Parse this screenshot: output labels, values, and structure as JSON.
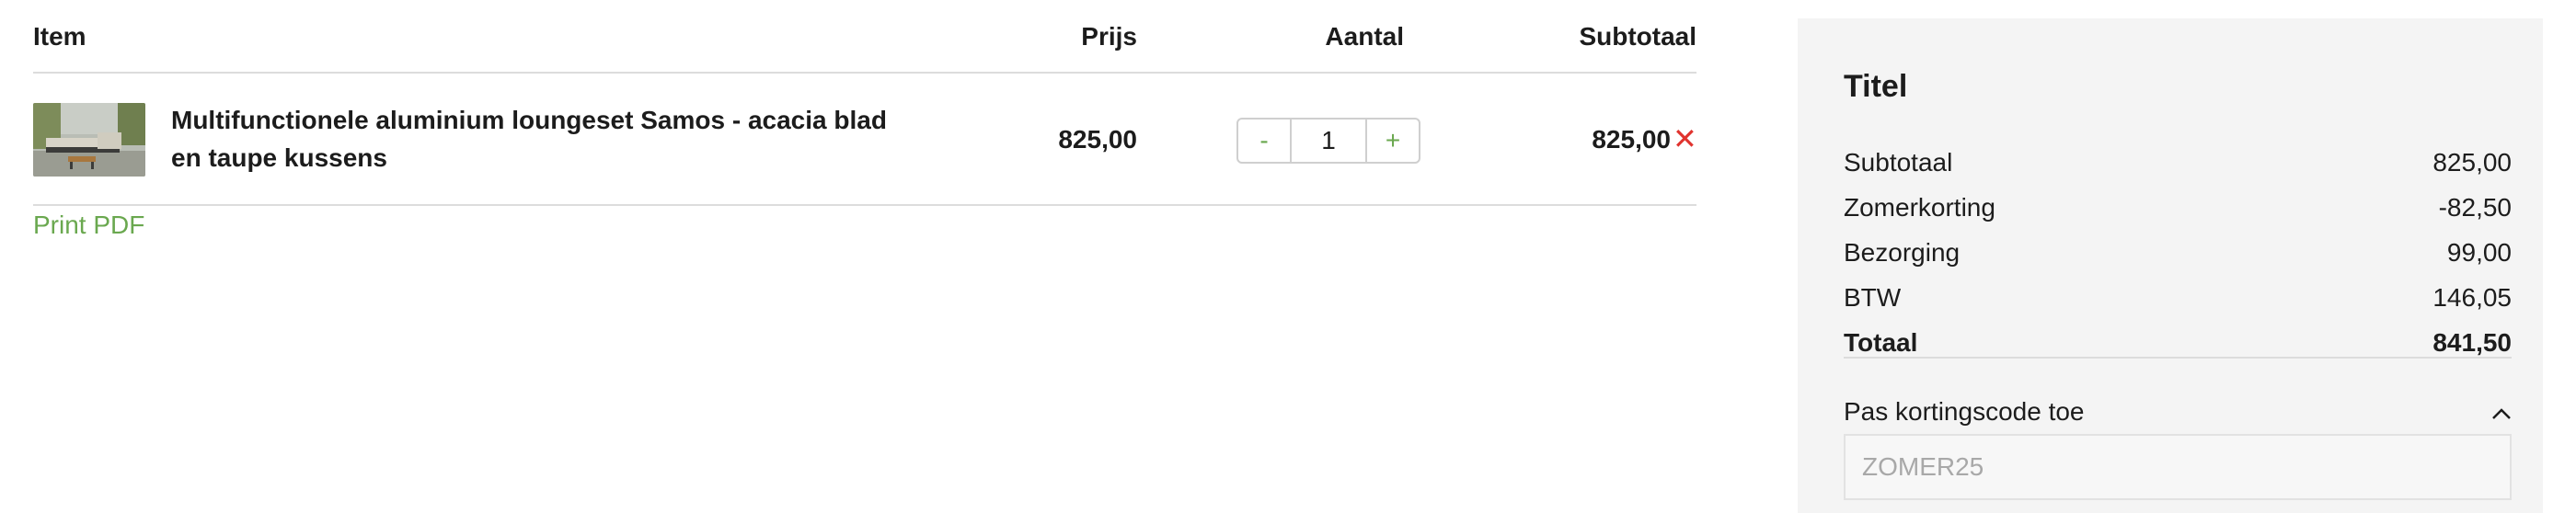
{
  "cart": {
    "headers": {
      "item": "Item",
      "price": "Prijs",
      "quantity": "Aantal",
      "subtotal": "Subtotaal"
    },
    "rows": [
      {
        "name": "Multifunctionele aluminium loungeset Samos - acacia blad en taupe kussens",
        "price": "825,00",
        "quantity": "1",
        "subtotal": "825,00",
        "thumbnail_icon": "outdoor-lounge-set-photo"
      }
    ],
    "qty_minus_label": "-",
    "qty_plus_label": "+",
    "remove_icon": "close-icon",
    "print_link": "Print PDF"
  },
  "summary": {
    "title": "Titel",
    "lines": [
      {
        "label": "Subtotaal",
        "value": "825,00"
      },
      {
        "label": "Zomerkorting",
        "value": "-82,50"
      },
      {
        "label": "Bezorging",
        "value": "99,00"
      },
      {
        "label": "BTW",
        "value": "146,05"
      }
    ],
    "total": {
      "label": "Totaal",
      "value": "841,50"
    },
    "discount_toggle_label": "Pas kortingscode toe",
    "discount_placeholder": "ZOMER25",
    "discount_value": ""
  },
  "colors": {
    "accent": "#6aa84f",
    "remove": "#e0332e",
    "panel_bg": "#f4f4f4",
    "divider": "#dcdcdc"
  }
}
